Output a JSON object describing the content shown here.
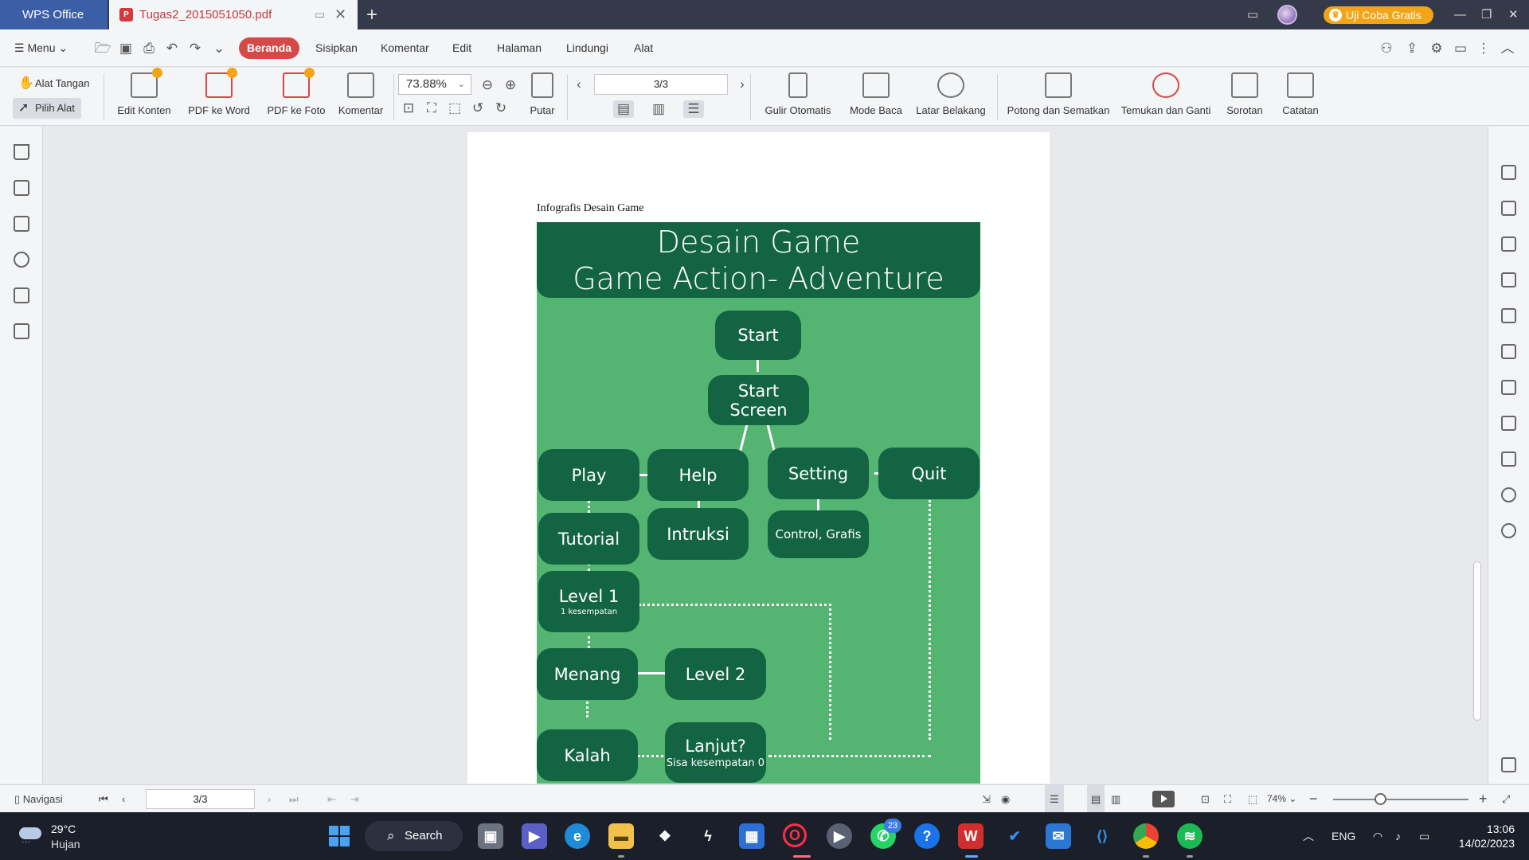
{
  "window": {
    "app_tab": "WPS Office",
    "doc_tab": "Tugas2_2015051050.pdf",
    "trial_label": "Uji Coba Gratis"
  },
  "menu": {
    "menu_label": "Menu",
    "tabs": [
      "Beranda",
      "Sisipkan",
      "Komentar",
      "Edit",
      "Halaman",
      "Lindungi",
      "Alat"
    ]
  },
  "ribbon": {
    "hand_tool": "Alat Tangan",
    "select_tool": "Pilih Alat",
    "edit_content": "Edit Konten",
    "pdf_to_word": "PDF ke Word",
    "pdf_to_photo": "PDF ke Foto",
    "comment": "Komentar",
    "zoom": "73.88%",
    "rotate": "Putar",
    "page_indicator": "3/3",
    "auto_scroll": "Gulir Otomatis",
    "read_mode": "Mode Baca",
    "background": "Latar Belakang",
    "crop_embed": "Potong dan Sematkan",
    "find_replace": "Temukan dan Ganti",
    "highlight": "Sorotan",
    "note": "Catatan"
  },
  "document": {
    "caption": "Infografis Desain Game",
    "infographic": {
      "title_line1": "Desain Game",
      "title_line2": "Game Action- Adventure",
      "nodes": {
        "start": "Start",
        "start_screen": "Start Screen",
        "play": "Play",
        "help": "Help",
        "setting": "Setting",
        "quit": "Quit",
        "tutorial": "Tutorial",
        "intruksi": "Intruksi",
        "control": "Control, Grafis",
        "level1": "Level 1",
        "level1_sub": "1 kesempatan",
        "menang": "Menang",
        "level2": "Level 2",
        "kalah": "Kalah",
        "lanjut": "Lanjut?",
        "lanjut_sub": "Sisa kesempatan 0"
      }
    }
  },
  "statusbar": {
    "navigation": "Navigasi",
    "page_indicator": "3/3",
    "zoom": "74%"
  },
  "taskbar": {
    "temperature": "29°C",
    "weather": "Hujan",
    "search": "Search",
    "whatsapp_badge": "23",
    "language": "ENG",
    "time": "13:06",
    "date": "14/02/2023"
  },
  "colors": {
    "infographic_bg": "#54b573",
    "node_fill": "#136442",
    "accent_red": "#d64949",
    "trial_orange": "#f3a517"
  }
}
